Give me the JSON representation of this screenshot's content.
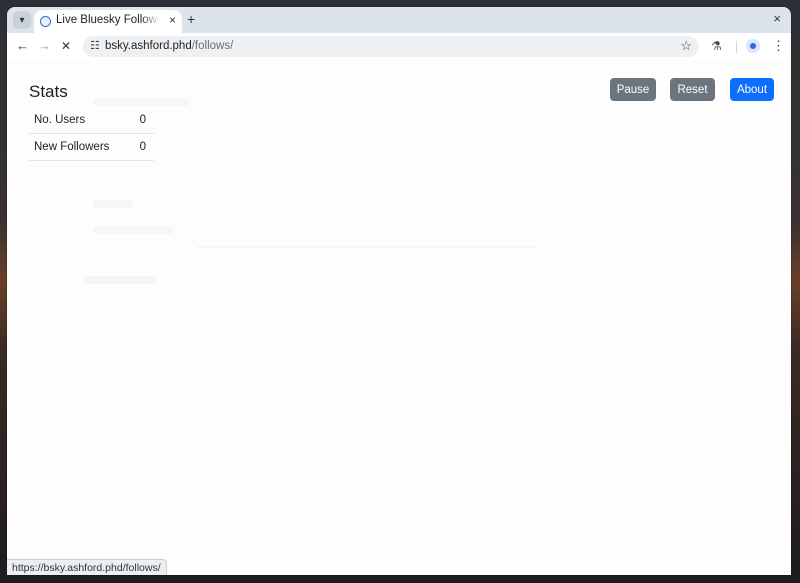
{
  "browser": {
    "tab_title": "Live Bluesky Follower Monitor",
    "new_tab_symbol": "+",
    "tab_close_symbol": "×",
    "window_close_symbol": "×",
    "url_host": "bsky.ashford.phd",
    "url_path": "/follows/",
    "status_url": "https://bsky.ashford.phd/follows/"
  },
  "icons": {
    "tab_menu": "chevron-down-icon",
    "back": "arrow-left-icon",
    "forward": "arrow-right-icon",
    "stop": "close-icon",
    "site_info": "tune-icon",
    "bookmark": "star-icon",
    "labs": "flask-icon",
    "profile": "profile-icon",
    "menu": "kebab-icon"
  },
  "stats": {
    "title": "Stats",
    "rows": [
      {
        "label": "No. Users",
        "value": "0"
      },
      {
        "label": "New Followers",
        "value": "0"
      }
    ]
  },
  "actions": {
    "pause_label": "Pause",
    "reset_label": "Reset",
    "about_label": "About"
  },
  "colors": {
    "secondary_button": "#6c757d",
    "primary_button": "#0d6efd"
  }
}
